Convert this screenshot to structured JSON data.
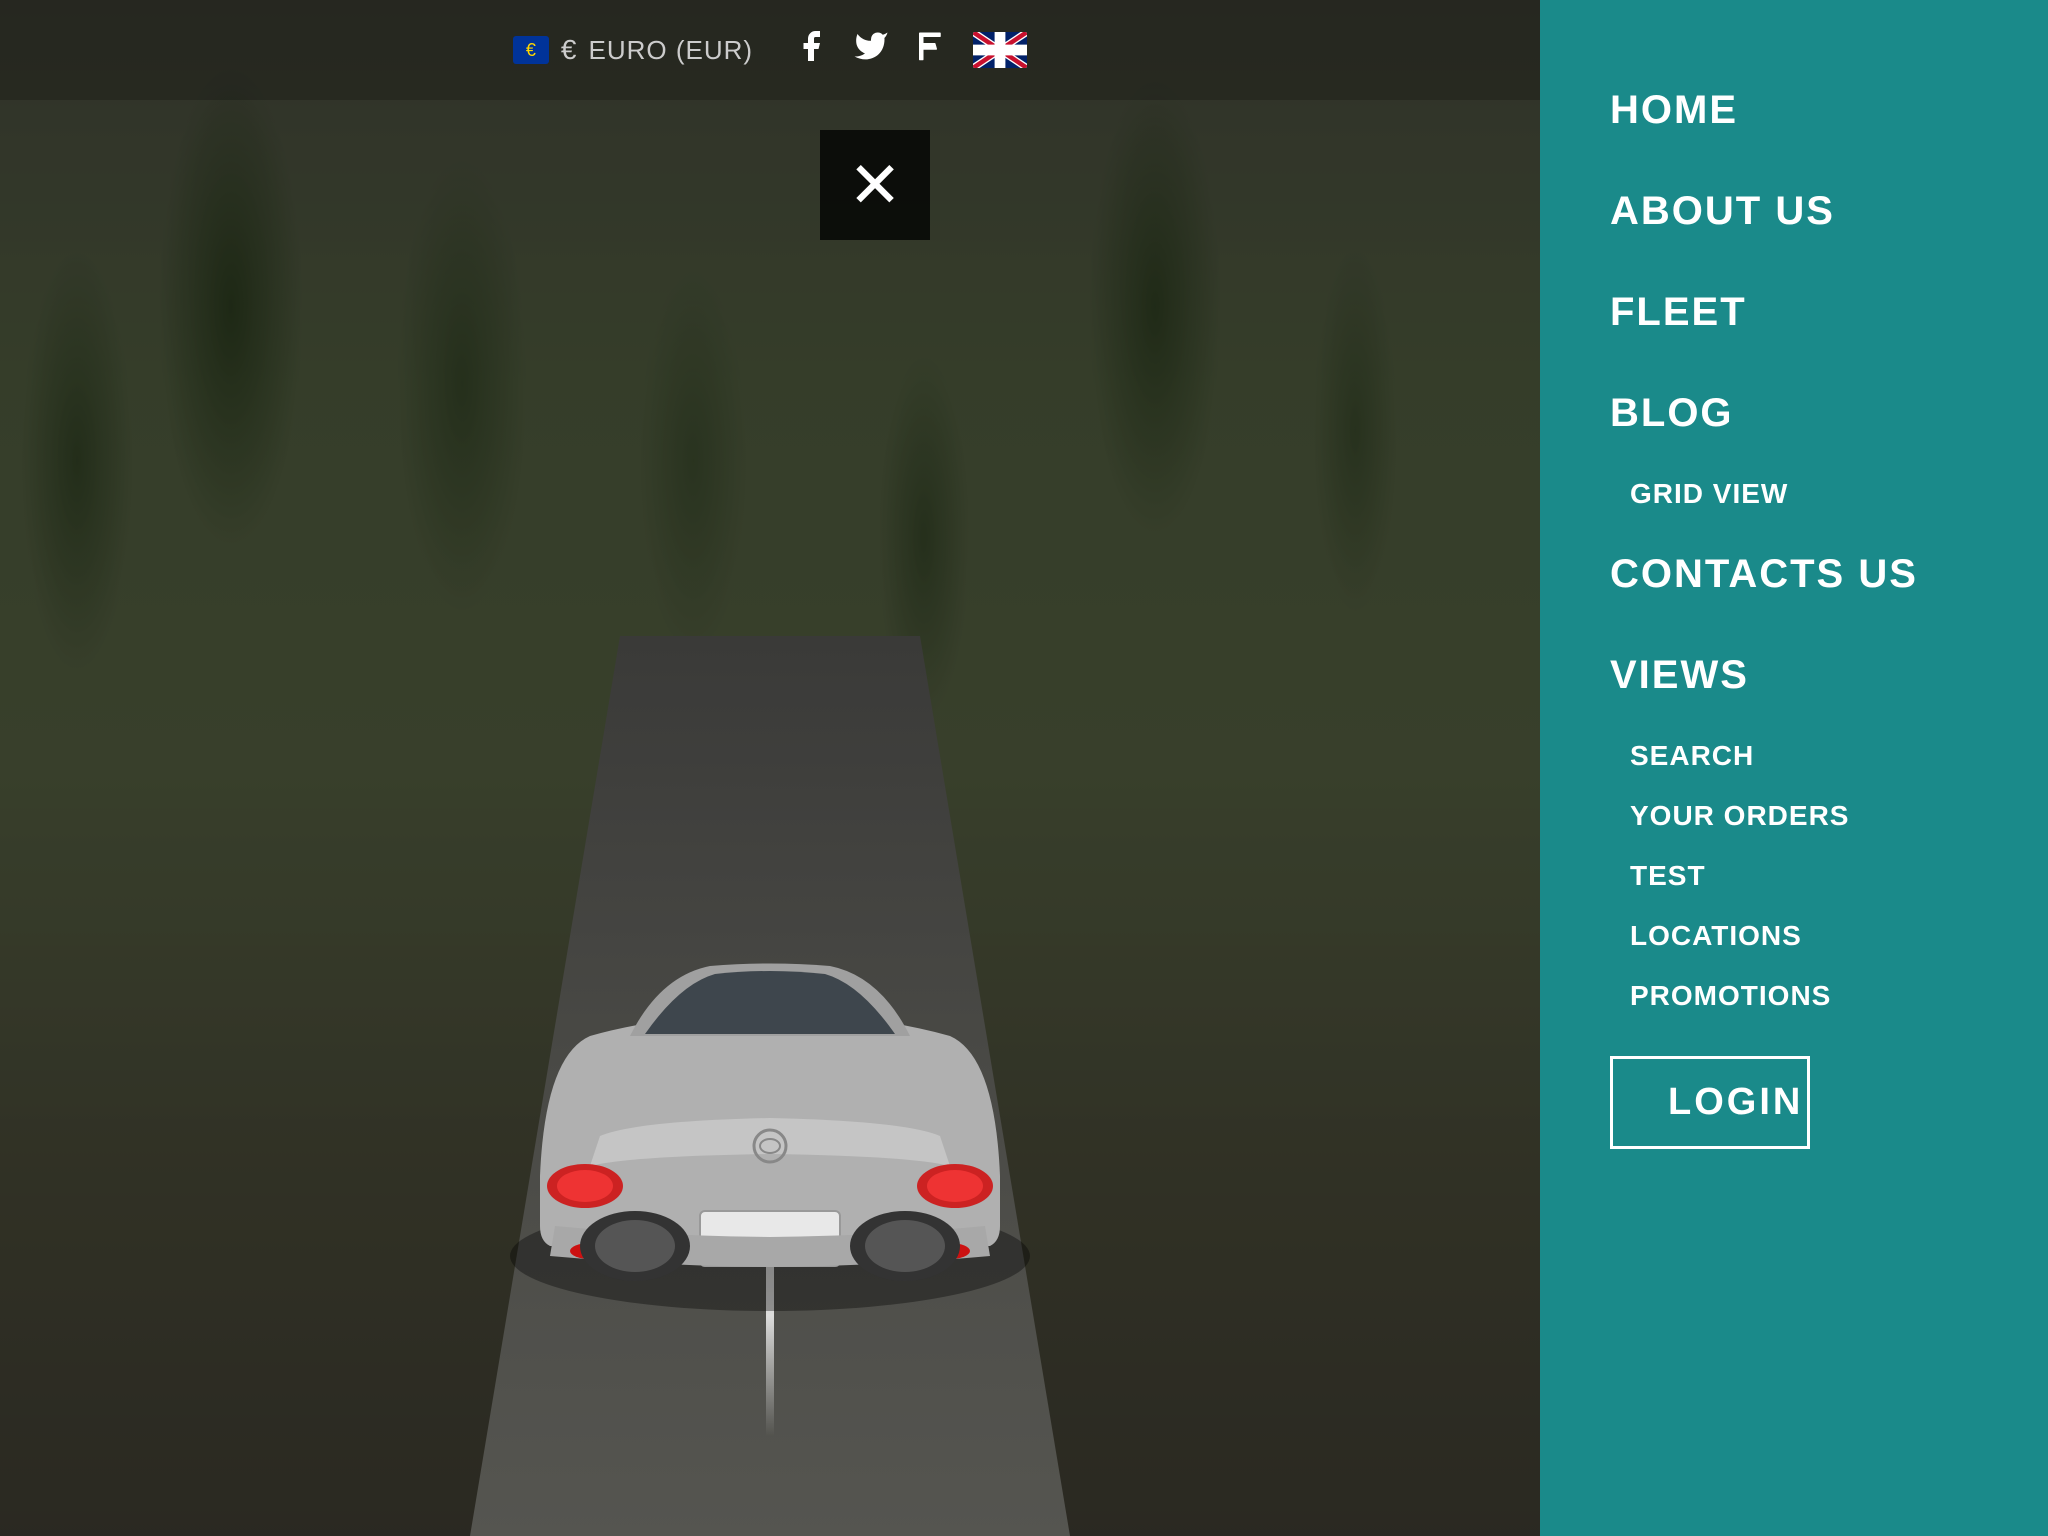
{
  "header": {
    "currency_flag": "€",
    "currency_symbol": "€",
    "currency_label": "EURO (EUR)"
  },
  "social": {
    "facebook_icon": "f",
    "twitter_icon": "t",
    "foursquare_icon": "4"
  },
  "close_button_label": "✕",
  "nav": {
    "items": [
      {
        "id": "home",
        "label": "HOME",
        "type": "main"
      },
      {
        "id": "about",
        "label": "ABOUT US",
        "type": "main"
      },
      {
        "id": "fleet",
        "label": "FLEET",
        "type": "main"
      },
      {
        "id": "blog",
        "label": "BLOG",
        "type": "main"
      },
      {
        "id": "grid-view",
        "label": "GRID VIEW",
        "type": "sub"
      },
      {
        "id": "contacts",
        "label": "CONTACTS US",
        "type": "main"
      },
      {
        "id": "views",
        "label": "VIEWS",
        "type": "main"
      },
      {
        "id": "search",
        "label": "SEARCH",
        "type": "sub"
      },
      {
        "id": "your-orders",
        "label": "YOUR ORDERS",
        "type": "sub"
      },
      {
        "id": "test",
        "label": "TEST",
        "type": "sub"
      },
      {
        "id": "locations",
        "label": "LOCATIONS",
        "type": "sub"
      },
      {
        "id": "promotions",
        "label": "PROMOTIONS",
        "type": "sub"
      }
    ],
    "login_label": "LOGIN"
  }
}
